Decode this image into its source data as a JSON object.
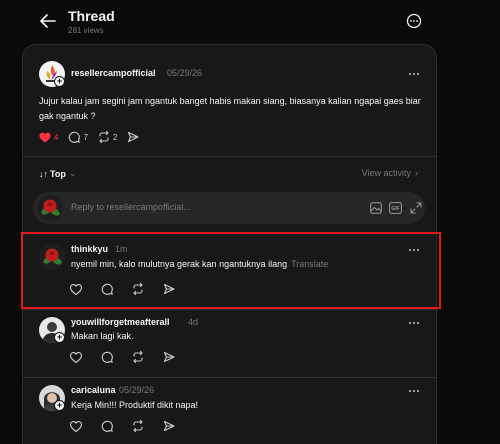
{
  "header": {
    "title": "Thread",
    "views": "281 views"
  },
  "post": {
    "username": "resellercampofficial",
    "date": "05/29/26",
    "text": "Jujur kalau jam segini jam ngantuk banget habis makan siang, biasanya kalian ngapai gaes biar gak ngantuk ?",
    "likes": "4",
    "comments": "7",
    "reposts": "2"
  },
  "sort": {
    "label": "Top",
    "view_activity": "View activity"
  },
  "reply": {
    "placeholder": "Reply to resellercampofficial..."
  },
  "comments": [
    {
      "username": "thinkkyu",
      "time": "1m",
      "text": "nyemil min, kalo mulutnya gerak kan ngantuknya ilang",
      "translate": "Translate"
    },
    {
      "username": "youwillforgetmeafterall",
      "time": "4d",
      "text": "Makan lagi kak."
    },
    {
      "username": "caricaluna",
      "time": "05/29/26",
      "text": "Kerja Min!!! Produktif dikit napa!"
    }
  ],
  "colors": {
    "background": "#0a0a0a",
    "card": "#181818",
    "like_red": "#ff3040",
    "highlight_border": "#e01b1b"
  },
  "icons": [
    "arrow-left-icon",
    "more-circle-icon",
    "heart-icon",
    "comment-icon",
    "repost-icon",
    "share-icon",
    "image-icon",
    "gif-icon",
    "expand-icon"
  ]
}
